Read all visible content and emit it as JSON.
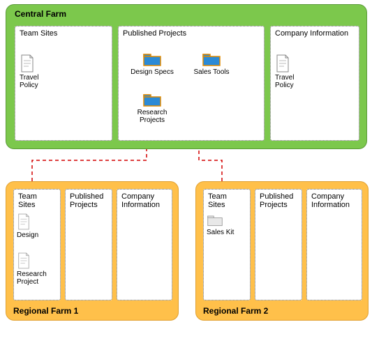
{
  "central": {
    "title": "Central Farm",
    "subs": {
      "team_sites": {
        "title": "Team Sites",
        "items": {
          "travel_policy": "Travel\nPolicy"
        }
      },
      "published_projects": {
        "title": "Published Projects",
        "items": {
          "design_specs": "Design Specs",
          "sales_tools": "Sales Tools",
          "research_projects": "Research\nProjects"
        }
      },
      "company_info": {
        "title": "Company Information",
        "items": {
          "travel_policy": "Travel\nPolicy"
        }
      }
    }
  },
  "regional1": {
    "title": "Regional Farm 1",
    "subs": {
      "team_sites": {
        "title": "Team Sites",
        "items": {
          "design": "Design",
          "research_project": "Research\nProject"
        }
      },
      "published_projects": {
        "title": "Published\nProjects"
      },
      "company_info": {
        "title": "Company\nInformation"
      }
    }
  },
  "regional2": {
    "title": "Regional Farm 2",
    "subs": {
      "team_sites": {
        "title": "Team Sites",
        "items": {
          "sales_kit": "Sales Kit"
        }
      },
      "published_projects": {
        "title": "Published\nProjects"
      },
      "company_info": {
        "title": "Company\nInformation"
      }
    }
  },
  "chart_data": {
    "type": "diagram",
    "nodes": [
      {
        "id": "central",
        "label": "Central Farm",
        "type": "farm"
      },
      {
        "id": "regional1",
        "label": "Regional Farm 1",
        "type": "farm"
      },
      {
        "id": "regional2",
        "label": "Regional Farm 2",
        "type": "farm"
      },
      {
        "id": "central.team_sites",
        "label": "Team Sites",
        "type": "subsite",
        "parent": "central"
      },
      {
        "id": "central.published",
        "label": "Published Projects",
        "type": "subsite",
        "parent": "central"
      },
      {
        "id": "central.company_info",
        "label": "Company Information",
        "type": "subsite",
        "parent": "central"
      },
      {
        "id": "central.travel_policy_src",
        "label": "Travel Policy",
        "type": "document",
        "parent": "central.team_sites"
      },
      {
        "id": "central.design_specs",
        "label": "Design Specs",
        "type": "folder",
        "parent": "central.published"
      },
      {
        "id": "central.sales_tools",
        "label": "Sales Tools",
        "type": "folder",
        "parent": "central.published"
      },
      {
        "id": "central.research_projects",
        "label": "Research Projects",
        "type": "folder",
        "parent": "central.published"
      },
      {
        "id": "central.travel_policy_pub",
        "label": "Travel Policy",
        "type": "document",
        "parent": "central.company_info"
      },
      {
        "id": "r1.team_sites",
        "label": "Team Sites",
        "type": "subsite",
        "parent": "regional1"
      },
      {
        "id": "r1.published",
        "label": "Published Projects",
        "type": "subsite",
        "parent": "regional1"
      },
      {
        "id": "r1.company_info",
        "label": "Company Information",
        "type": "subsite",
        "parent": "regional1"
      },
      {
        "id": "r1.design",
        "label": "Design",
        "type": "document",
        "parent": "r1.team_sites"
      },
      {
        "id": "r1.research_project",
        "label": "Research Project",
        "type": "document",
        "parent": "r1.team_sites"
      },
      {
        "id": "r2.team_sites",
        "label": "Team Sites",
        "type": "subsite",
        "parent": "regional2"
      },
      {
        "id": "r2.published",
        "label": "Published Projects",
        "type": "subsite",
        "parent": "regional2"
      },
      {
        "id": "r2.company_info",
        "label": "Company Information",
        "type": "subsite",
        "parent": "regional2"
      },
      {
        "id": "r2.sales_kit",
        "label": "Sales Kit",
        "type": "document",
        "parent": "r2.team_sites"
      }
    ],
    "edges": [
      {
        "from": "central.travel_policy_src",
        "to": "central.travel_policy_pub",
        "style": "solid"
      },
      {
        "from": "r1.team_sites",
        "to": "central.design_specs",
        "style": "dashed"
      },
      {
        "from": "r2.team_sites",
        "to": "central.sales_tools",
        "style": "dashed"
      }
    ]
  }
}
